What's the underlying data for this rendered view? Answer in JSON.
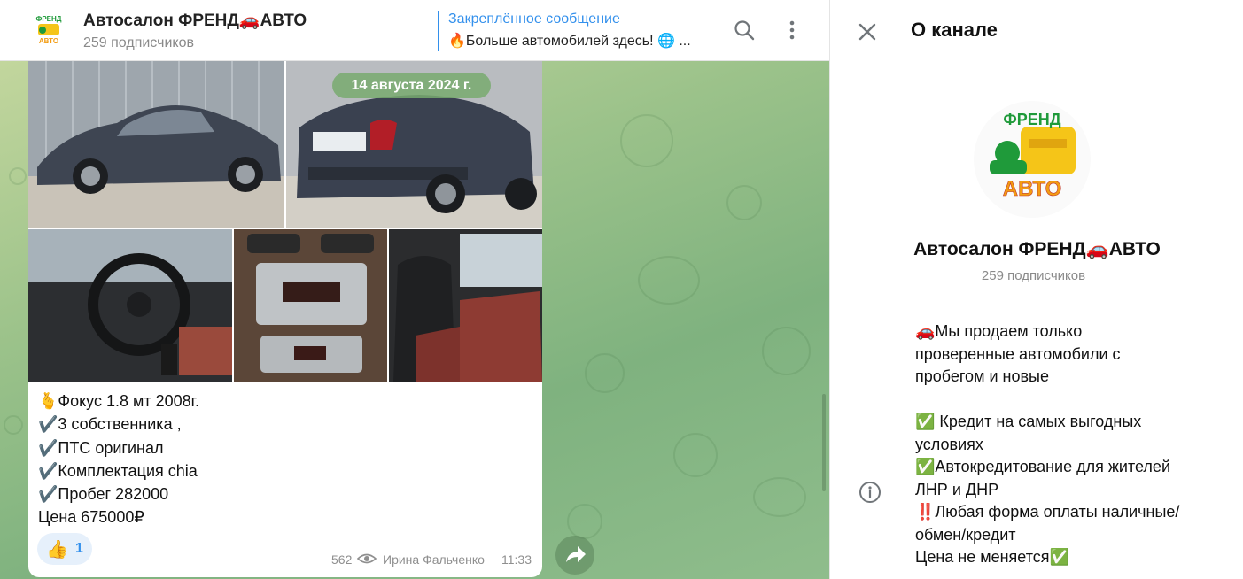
{
  "channel": {
    "title": "Автосалон ФРЕНД🚗АВТО",
    "subscribers": "259 подписчиков",
    "logo_top": "ФРЕНД",
    "logo_bottom": "АВТО"
  },
  "pinned": {
    "title": "Закреплённое сообщение",
    "text": "🔥Больше автомобилей здесь! 🌐 ..."
  },
  "header_icons": [
    "search-icon",
    "more-vertical-icon"
  ],
  "message": {
    "date": "14 августа 2024 г.",
    "lines": [
      "🫰Фокус 1.8 мт 2008г.",
      "✔️3 собственника ,",
      "✔️ПТС оригинал",
      "✔️Комплектация chia",
      "✔️Пробег 282000",
      "Цена 675000₽"
    ],
    "reaction": {
      "emoji": "👍",
      "count": "1"
    },
    "views": "562",
    "author": "Ирина Фальченко",
    "time": "11:33"
  },
  "panel": {
    "title": "О канале",
    "name": "Автосалон ФРЕНД🚗АВТО",
    "subscribers": "259 подписчиков",
    "description": [
      "🚗Мы продаем только",
      "проверенные автомобили с",
      "пробегом и новые",
      "",
      "✅ Кредит на самых выгодных",
      "условиях",
      "✅Автокредитование для жителей",
      "ЛНР и ДНР",
      "‼️Любая форма оплаты наличные/",
      "обмен/кредит",
      "Цена не меняется✅"
    ]
  },
  "colors": {
    "accent": "#3390ec",
    "logo_green": "#1f9a3a",
    "logo_orange": "#f39c12"
  }
}
